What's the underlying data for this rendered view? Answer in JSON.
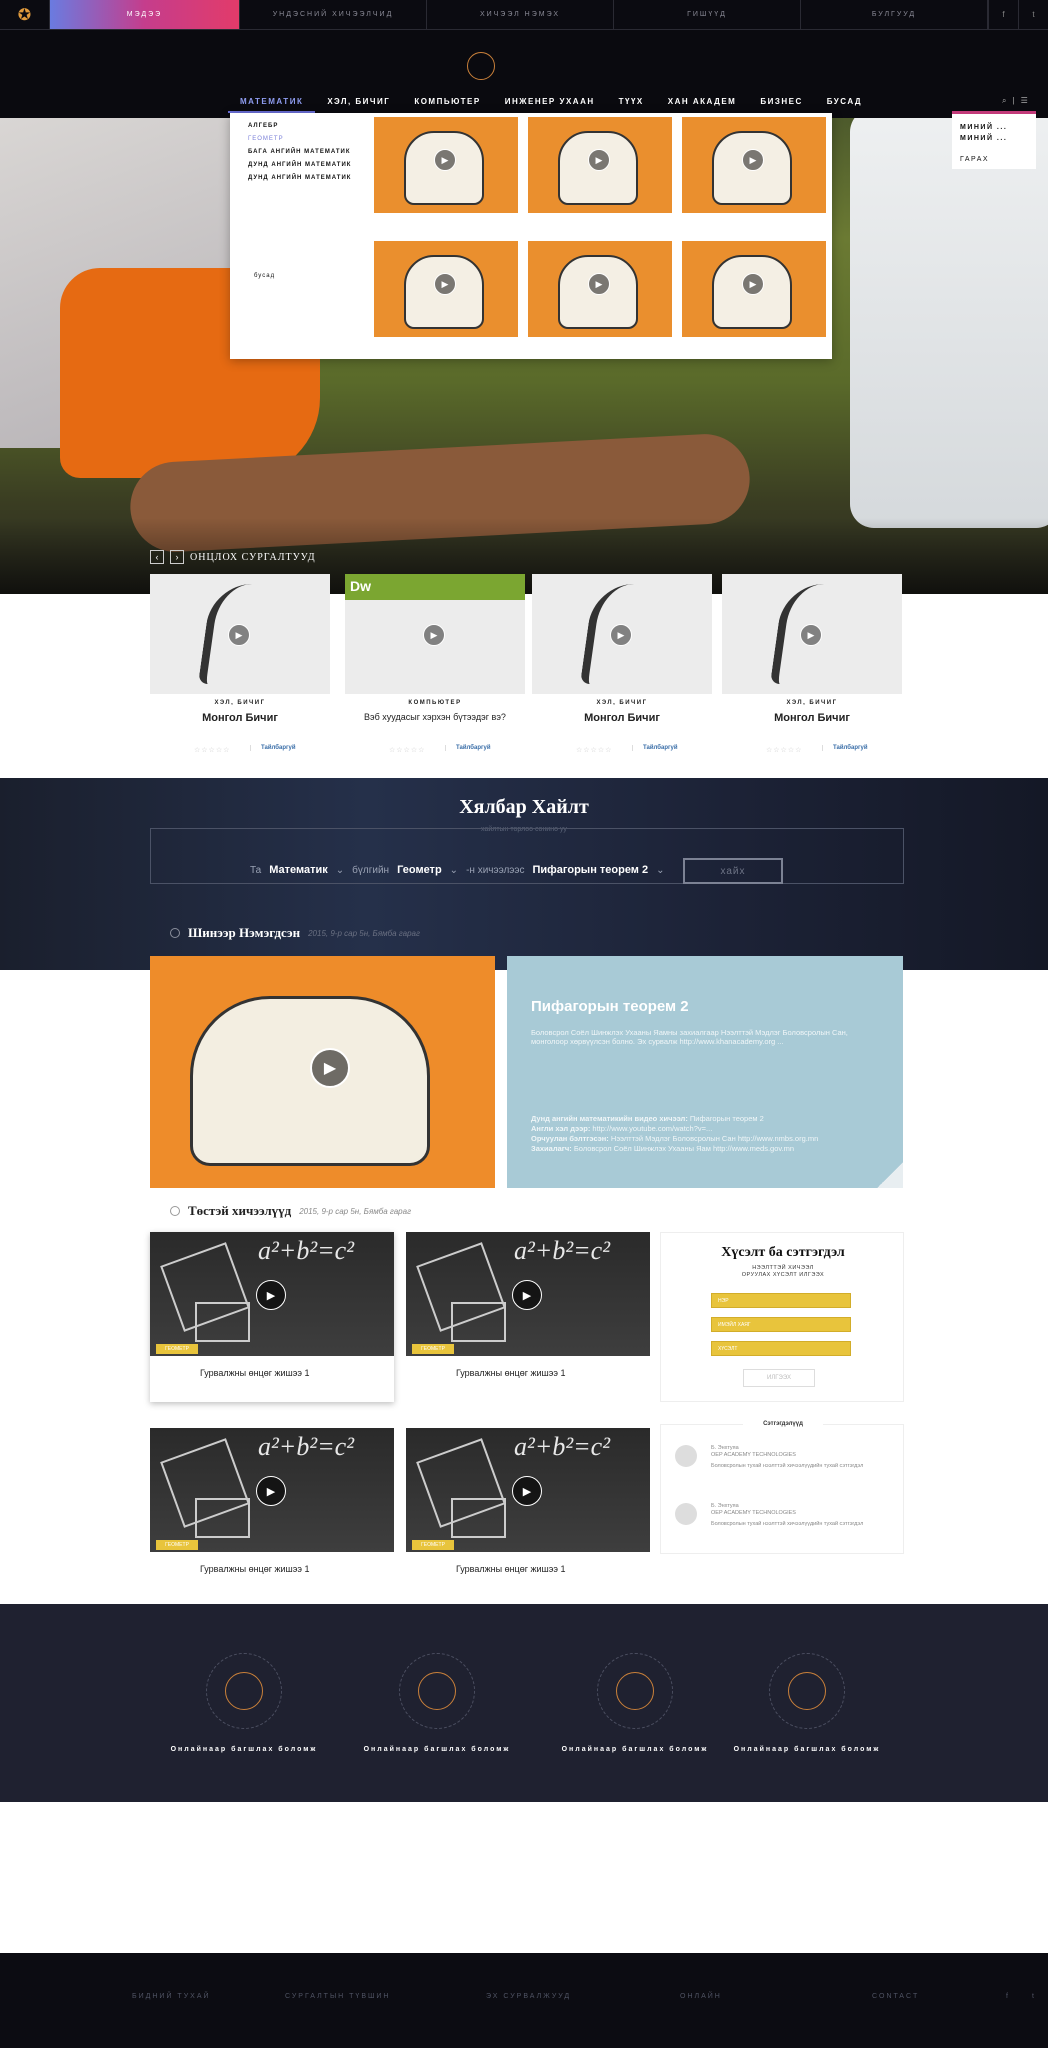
{
  "topbar": {
    "items": [
      "МЭДЭЭ",
      "УНДЭСНИЙ ХИЧЭЭЛЧИД",
      "ХИЧЭЭЛ НЭМЭХ",
      "ГИШҮҮД",
      "БУЛГУУД"
    ],
    "social": [
      "f",
      "t"
    ]
  },
  "mainnav": {
    "items": [
      "МАТЕМАТИК",
      "ХЭЛ, БИЧИГ",
      "КОМПЬЮТЕР",
      "ИНЖЕНЕР УХААН",
      "ТҮҮХ",
      "ХАН АКАДЕМ",
      "БИЗНЕС",
      "БУСАД"
    ]
  },
  "mega": {
    "items": [
      "АЛГЕБР",
      "ГЕОМЕТР",
      "БАГА АНГИЙН МАТЕМАТИК",
      "ДУНД АНГИЙН МАТЕМАТИК",
      "ДУНД АНГИЙН МАТЕМАТИК"
    ],
    "other": "бусад"
  },
  "rdrop": {
    "items": [
      "МИНИЙ ...",
      "МИНИЙ ...",
      "ГАРАХ"
    ]
  },
  "featured": {
    "title": "ОНЦЛОХ СУРГАЛТУУД",
    "cards": [
      {
        "cat": "ХЭЛ, БИЧИГ",
        "title": "Монгол Бичиг",
        "link": "Тайлбаргуй"
      },
      {
        "cat": "КОМПЬЮТЕР",
        "title": "Вэб хуудасыг хэрхэн бүтээдэг вэ?",
        "link": "Тайлбаргуй",
        "logo": "Dw"
      },
      {
        "cat": "ХЭЛ, БИЧИГ",
        "title": "Монгол Бичиг",
        "link": "Тайлбаргуй"
      },
      {
        "cat": "ХЭЛ, БИЧИГ",
        "title": "Монгол Бичиг",
        "link": "Тайлбаргуй"
      }
    ]
  },
  "search": {
    "title": "Хялбар Хайлт",
    "subtitle": "хайлтын торлоо сонино уу",
    "ta": "Та",
    "subject": "Математик",
    "mid": "бүлгийн",
    "topic": "Геометр",
    "tail": "-н хичээлээс",
    "lesson": "Пифагорын теорем 2",
    "button": "хайх"
  },
  "newest": {
    "title": "Шинээр Нэмэгдсэн",
    "date": "2015, 9-р сар 5н, Бямба гараг"
  },
  "lesson": {
    "title": "Пифагорын теорем 2",
    "desc": "Боловсрол Соёл Шинжлэх Ухааны Яамны захиалгаар Нээлттэй Мэдлэг Боловсролын Сан, монголоор хөрвүүлсэн болно. Эх сурвалж http://www.khanacademy.org ...",
    "l1": "Дунд ангийн математикийн видео хичээл:",
    "l1v": " Пифагорын теорем 2",
    "l2": "Англи хэл дээр:",
    "l2v": " http://www.youtube.com/watch?v=...",
    "l3": "Орчуулан бэлтгэсэн:",
    "l3v": " Нээлттэй Мэдлэг Боловсролын Сан http://www.nmbs.org.mn",
    "l4": "Захиалагч:",
    "l4v": " Боловсрол Соёл Шинжлэх Ухааны Яам http://www.meds.gov.mn"
  },
  "related": {
    "title": "Төстэй хичээлүүд",
    "date": "2015, 9-р сар 5н, Бямба гараг",
    "cards": [
      {
        "title": "Гурвалжны өнцөг жишээ 1",
        "tag": "ГЕОМЕТР"
      },
      {
        "title": "Гурвалжны өнцөг жишээ 1",
        "tag": "ГЕОМЕТР"
      },
      {
        "title": "Гурвалжны өнцөг жишээ 1",
        "tag": "ГЕОМЕТР"
      },
      {
        "title": "Гурвалжны өнцөг жишээ 1",
        "tag": "ГЕОМЕТР"
      }
    ],
    "equation": "a²+b²=c²"
  },
  "wish": {
    "title": "Хүсэлт ба сэтгэгдэл",
    "sub": "НЭЭЛТТЭЙ ХИЧЭЭЛ\nОРУУЛАХ ХҮСЭЛТ ИЛГЭЭХ",
    "fields": [
      "НЭР",
      "ИМЭЙЛ ХАЯГ",
      "ХҮСЭЛТ"
    ],
    "button": "ИЛГЭЭХ"
  },
  "comments": {
    "title": "Сэтгэгдэлүүд",
    "items": [
      {
        "name": "Б. Энхтуяа",
        "org": "OEP ACADEMY TECHNOLOGIES",
        "text": "Боловсролын тухай нээлттэй хичээлүүдийн тухай сэтгэгдэл"
      },
      {
        "name": "Б. Энхтуяа",
        "org": "OEP ACADEMY TECHNOLOGIES",
        "text": "Боловсролын тухай нээлттэй хичээлүүдийн тухай сэтгэгдэл"
      }
    ]
  },
  "features": {
    "labels": [
      "Онлайнаар багшлах боломж",
      "Онлайнаар багшлах боломж",
      "Онлайнаар багшлах боломж",
      "Онлайнаар багшлах боломж"
    ]
  },
  "footer": {
    "items": [
      "БИДНИЙ ТУХАЙ",
      "СУРГАЛТЫН ТҮВШИН",
      "ЭХ СУРВАЛЖУУД",
      "ОНЛАЙН",
      "CONTACT"
    ],
    "social": [
      "f",
      "t"
    ]
  },
  "colors": {
    "accent": "#6a6fd8",
    "orange": "#e66a12",
    "yellow": "#e8c43c",
    "lessonBlue": "#a8cad6",
    "dark": "#1f2130"
  }
}
